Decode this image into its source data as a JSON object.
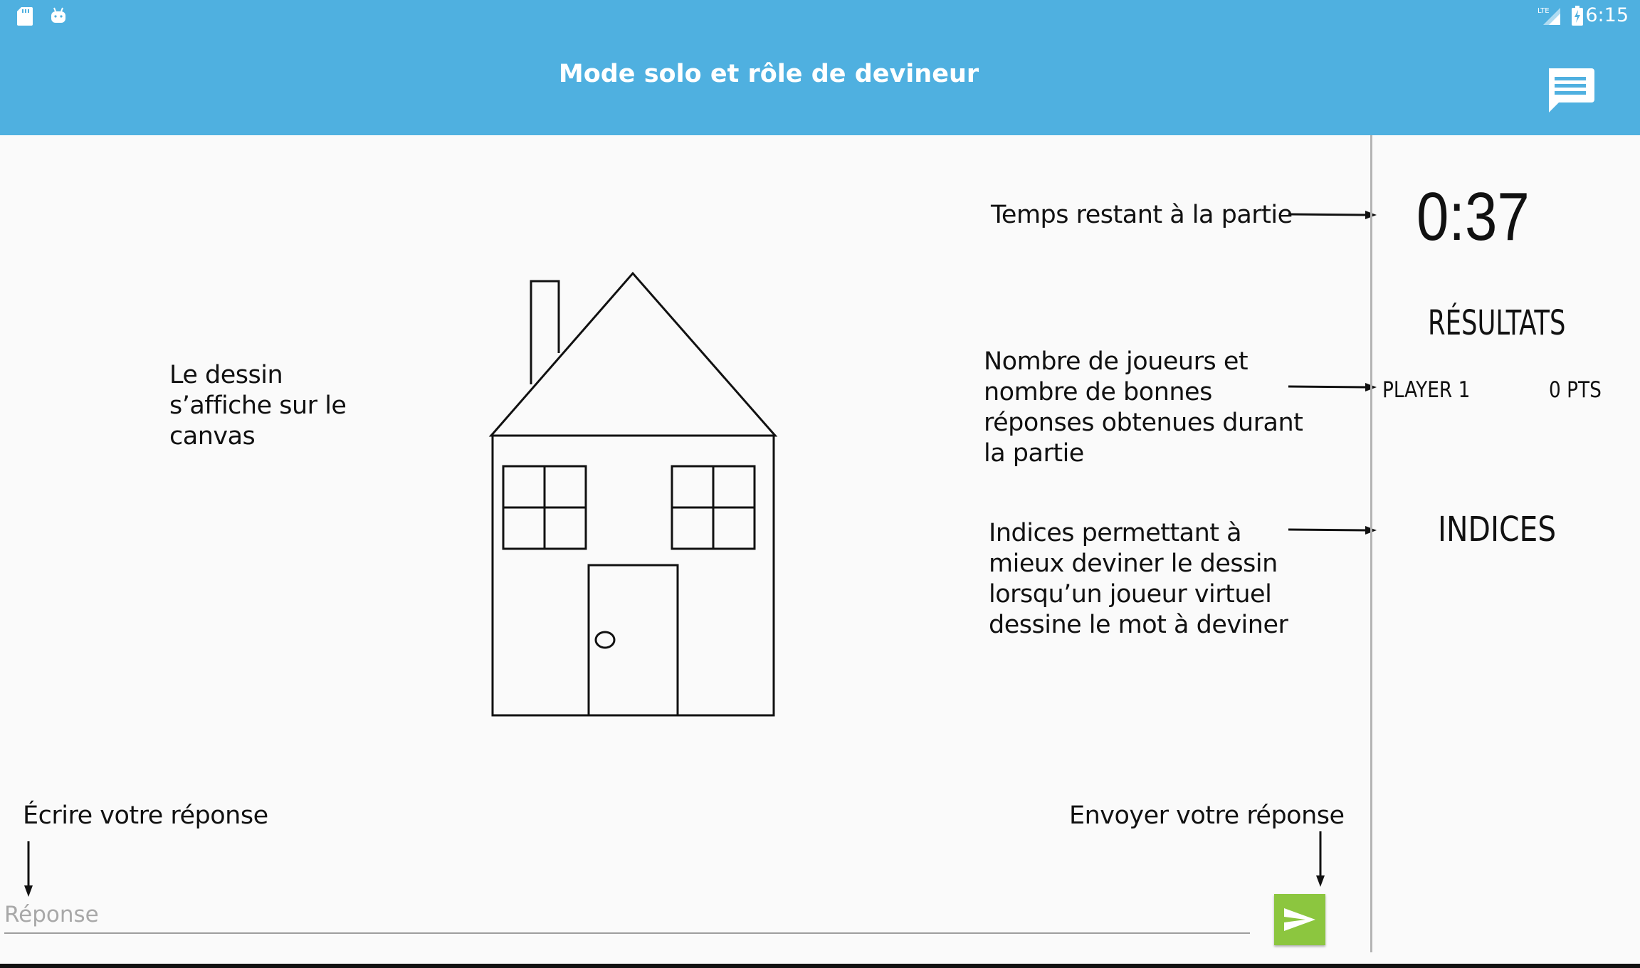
{
  "status_bar": {
    "time": "6:15",
    "left_icons": [
      "sd-card-icon",
      "android-icon"
    ],
    "right_icons": [
      "lte-signal-icon",
      "battery-charging-icon"
    ]
  },
  "app_bar": {
    "title": "Mode solo et rôle de devineur",
    "action_icon": "chat-icon",
    "color": "#4fb0e0"
  },
  "side_panel": {
    "timer": "0:37",
    "results_heading": "RÉSULTATS",
    "players": [
      {
        "name": "PLAYER 1",
        "score": "0 PTS"
      }
    ],
    "hints_heading": "INDICES"
  },
  "annotations": {
    "canvas_note": [
      "Le dessin",
      "s’affiche sur le",
      "canvas"
    ],
    "timer_note": "Temps restant à la partie",
    "players_note": [
      "Nombre de joueurs et",
      "nombre de bonnes",
      "réponses obtenues durant",
      "la partie"
    ],
    "hints_note": [
      "Indices permettant à",
      "mieux deviner le dessin",
      "lorsqu’un joueur virtuel",
      "dessine le mot à deviner"
    ],
    "write_note": "Écrire votre réponse",
    "send_note": "Envoyer votre réponse"
  },
  "answer": {
    "value": "",
    "placeholder": "Réponse"
  },
  "send_button": {
    "icon": "send-icon",
    "color": "#8cc63f"
  },
  "canvas": {
    "drawing": "house-drawing"
  }
}
